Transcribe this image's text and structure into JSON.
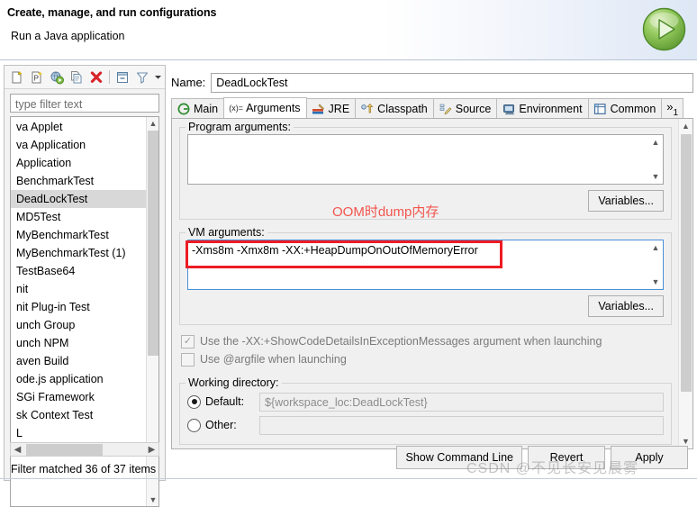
{
  "header": {
    "title": "Create, manage, and run configurations",
    "subtitle": "Run a Java application",
    "badge_icon": "run-play-icon",
    "badge_color": "#7dbb45"
  },
  "left_panel": {
    "toolbar": [
      {
        "name": "new-configuration-icon",
        "glyph": "new-doc"
      },
      {
        "name": "new-prototype-icon",
        "glyph": "new-proto"
      },
      {
        "name": "export-configuration-icon",
        "glyph": "globe-run"
      },
      {
        "name": "duplicate-configuration-icon",
        "glyph": "duplicate"
      },
      {
        "name": "delete-configuration-icon",
        "glyph": "red-x"
      },
      {
        "name": "collapse-all-icon",
        "glyph": "collapse"
      },
      {
        "name": "filter-icon",
        "glyph": "funnel"
      },
      {
        "name": "toolbar-menu-icon",
        "glyph": "chevron-down"
      }
    ],
    "filter_placeholder": "type filter text",
    "filter_value": "",
    "tree_items": [
      {
        "label": "va Applet",
        "selected": false
      },
      {
        "label": "va Application",
        "selected": false
      },
      {
        "label": "Application",
        "selected": false
      },
      {
        "label": "BenchmarkTest",
        "selected": false
      },
      {
        "label": "DeadLockTest",
        "selected": true
      },
      {
        "label": "MD5Test",
        "selected": false
      },
      {
        "label": "MyBenchmarkTest",
        "selected": false
      },
      {
        "label": "MyBenchmarkTest (1)",
        "selected": false
      },
      {
        "label": "TestBase64",
        "selected": false
      },
      {
        "label": "nit",
        "selected": false
      },
      {
        "label": "nit Plug-in Test",
        "selected": false
      },
      {
        "label": "unch Group",
        "selected": false
      },
      {
        "label": "unch NPM",
        "selected": false
      },
      {
        "label": "aven Build",
        "selected": false
      },
      {
        "label": "ode.js application",
        "selected": false
      },
      {
        "label": "SGi Framework",
        "selected": false
      },
      {
        "label": "sk Context Test",
        "selected": false
      },
      {
        "label": "L",
        "selected": false
      }
    ],
    "status": "Filter matched 36 of 37 items"
  },
  "main": {
    "name_label": "Name:",
    "name_value": "DeadLockTest",
    "tabs": [
      {
        "label": "Main",
        "icon": "main-class-icon",
        "active": false
      },
      {
        "label": "Arguments",
        "icon": "arguments-icon",
        "active": true
      },
      {
        "label": "JRE",
        "icon": "jre-icon",
        "active": false
      },
      {
        "label": "Classpath",
        "icon": "classpath-icon",
        "active": false
      },
      {
        "label": "Source",
        "icon": "source-icon",
        "active": false
      },
      {
        "label": "Environment",
        "icon": "environment-icon",
        "active": false
      },
      {
        "label": "Common",
        "icon": "common-icon",
        "active": false
      }
    ],
    "tab_overflow": "»",
    "tab_overflow_count": "1",
    "program_arguments": {
      "group_title": "Program arguments:",
      "value": "",
      "variables_button": "Variables..."
    },
    "vm_arguments": {
      "group_title": "VM arguments:",
      "value": "-Xms8m -Xmx8m -XX:+HeapDumpOnOutOfMemoryError",
      "variables_button": "Variables..."
    },
    "checkboxes": [
      {
        "label": "Use the -XX:+ShowCodeDetailsInExceptionMessages argument when launching",
        "checked": true,
        "enabled": false
      },
      {
        "label": "Use @argfile when launching",
        "checked": false,
        "enabled": false
      }
    ],
    "working_directory": {
      "group_title": "Working directory:",
      "default_label": "Default:",
      "default_value": "${workspace_loc:DeadLockTest}",
      "default_selected": true,
      "other_label": "Other:",
      "other_value": "",
      "other_selected": false
    }
  },
  "footer": {
    "buttons": [
      {
        "label": "Show Command Line",
        "name": "show-command-line-button"
      },
      {
        "label": "Revert",
        "name": "revert-button"
      },
      {
        "label": "Apply",
        "name": "apply-button"
      }
    ]
  },
  "annotations": {
    "note_text": "OOM时dump内存",
    "note_color": "#f2554d",
    "highlight_box_color": "#ed1c24",
    "watermark": "CSDN @不见长安见晨雾"
  }
}
